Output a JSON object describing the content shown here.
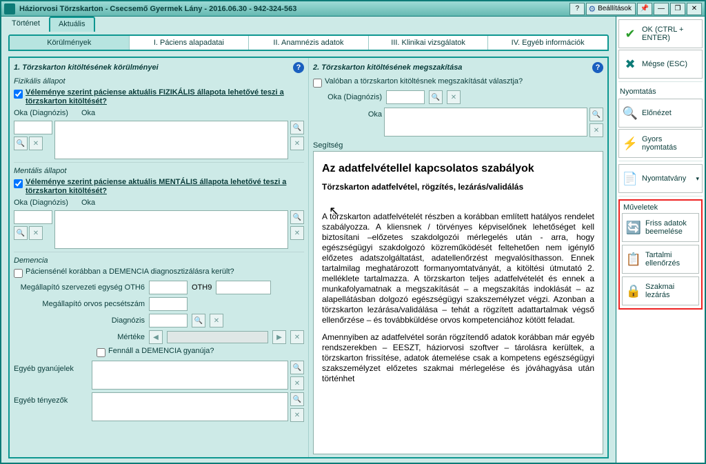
{
  "title": "Háziorvosi Törzskarton - Csecsemő Gyermek Lány - 2016.06.30 - 942-324-563",
  "titlebar_buttons": {
    "settings": "Beállítások",
    "help": "?",
    "min": "—",
    "restore": "❐",
    "close": "✕"
  },
  "top_tabs": {
    "history": "Történet",
    "current": "Aktuális"
  },
  "main_tabs": {
    "t1": "Körülmények",
    "t2": "I. Páciens alapadatai",
    "t3": "II. Anamnézis adatok",
    "t4": "III. Klinikai vizsgálatok",
    "t5": "IV. Egyéb információk"
  },
  "section1": {
    "heading": "1. Törzskarton kitöltésének körülményei",
    "phys_label": "Fizikális állapot",
    "phys_check": "Véleménye szerint páciense aktuális FIZIKÁLIS állapota lehetővé teszi a törzskarton kitöltését?",
    "oka_diag": "Oka (Diagnózis)",
    "oka": "Oka",
    "ment_label": "Mentális állapot",
    "ment_check": "Véleménye szerint páciense aktuális MENTÁLIS állapota lehetővé teszi a törzskarton kitöltését?",
    "dem_label": "Demencia",
    "dem_check": "Páciensénél korábban a DEMENCIA diagnosztizálásra került?",
    "dem_org": "Megállapító szervezeti egység OTH6",
    "dem_org9": "OTH9",
    "dem_stamp": "Megállapító orvos pecsétszám",
    "dem_diag": "Diagnózis",
    "dem_measure": "Mértéke",
    "dem_susp_check": "Fennáll a DEMENCIA gyanúja?",
    "other_susp": "Egyéb gyanújelek",
    "other_fact": "Egyéb tényezők"
  },
  "section2": {
    "heading": "2. Törzskarton kitöltésének megszakítása",
    "q_check": "Valóban a törzskarton kitöltésnek megszakítását választja?",
    "oka_diag": "Oka (Diagnózis)",
    "oka": "Oka",
    "help": "Segítség"
  },
  "help_content": {
    "h1": "Az adatfelvétellel kapcsolatos szabályok",
    "h2": "Törzskarton adatfelvétel, rögzítés, lezárás/validálás",
    "p1": "A törzskarton adatfelvételét részben a korábban említett  hatályos rendelet szabályozza.  A  kliensnek  /  törvényes  képviselőnek lehetőséget kell biztosítani –előzetes szakdolgozói mérlegelés után  - arra, hogy egészségügyi szakdolgozó közreműködését  feltehetően nem  igénylő  előzetes  adatszolgáltatást,  adatellenőrzést megvalósíthasson.  Ennek  tartalmilag  meghatározott formanyomtatványát, a kitöltési útmutató 2. melléklete tartalmazza. A törzskarton teljes adatfelvételét és ennek a munkafolyamatnak a megszakítását – a megszakítás indoklását – az alapellátásban dolgozó egészségügyi szakszemélyzet végzi. Azonban a  törzskarton lezárása/validálása – tehát a rögzített adattartalmak  végső ellenőrzése – és továbbküldése orvos kompetenciához  kötött feladat.",
    "p2": "Amennyiben az adatfelvétel során rögzítendő adatok korábban  már egyéb rendszerekben – EESZT, háziorvosi szoftver –  tárolásra kerültek, a törzskarton frissítése, adatok átemelése csak a kompetens egészségügyi szakszemélyzet előzetes szakmai mérlegelése  és jóváhagyása után történhet"
  },
  "right": {
    "ok": "OK (CTRL + ENTER)",
    "cancel": "Mégse (ESC)",
    "print_hdr": "Nyomtatás",
    "preview": "Előnézet",
    "quick": "Gyors nyomtatás",
    "form": "Nyomtatvány",
    "ops_hdr": "Műveletek",
    "refresh": "Friss adatok beemelése",
    "content_check": "Tartalmi ellenőrzés",
    "prof_close": "Szakmai lezárás"
  }
}
